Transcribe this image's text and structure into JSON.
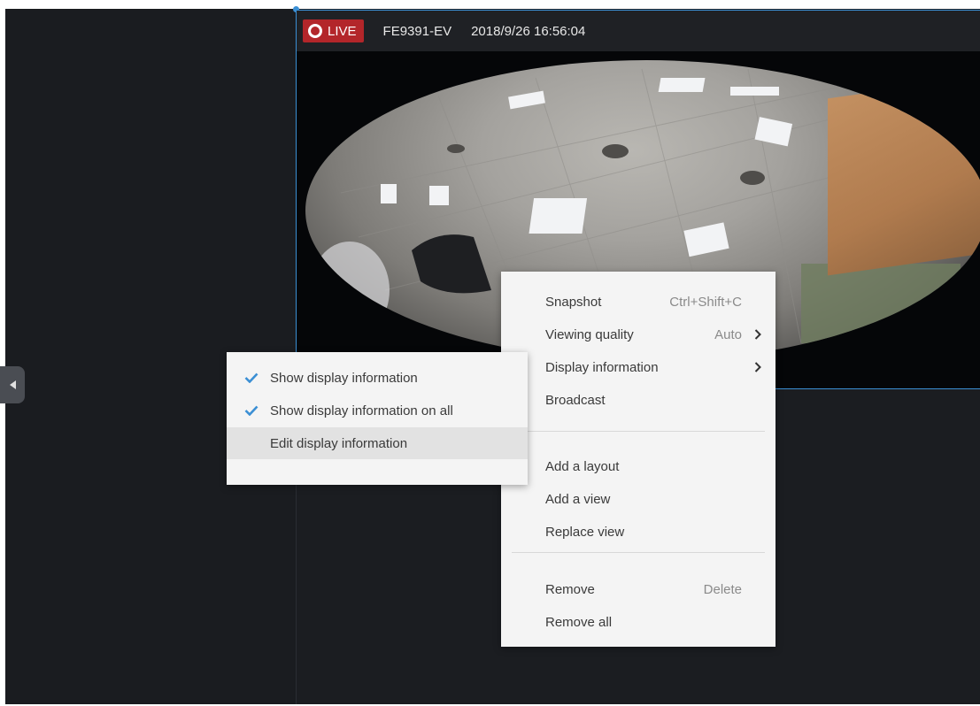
{
  "video": {
    "live_label": "LIVE",
    "camera_name": "FE9391-EV",
    "timestamp": "2018/9/26 16:56:04"
  },
  "context_menu": {
    "snapshot": {
      "label": "Snapshot",
      "shortcut": "Ctrl+Shift+C"
    },
    "viewing_quality": {
      "label": "Viewing quality",
      "value": "Auto"
    },
    "display_information": {
      "label": "Display information"
    },
    "broadcast": {
      "label": "Broadcast"
    },
    "add_layout": {
      "label": "Add a layout"
    },
    "add_view": {
      "label": "Add a view"
    },
    "replace_view": {
      "label": "Replace view"
    },
    "remove": {
      "label": "Remove",
      "shortcut": "Delete"
    },
    "remove_all": {
      "label": "Remove all"
    }
  },
  "submenu": {
    "show_display_information": {
      "label": "Show display information",
      "checked": true
    },
    "show_display_information_all": {
      "label": "Show display information on all",
      "checked": true
    },
    "edit_display_information": {
      "label": "Edit display information",
      "checked": false
    }
  },
  "colors": {
    "accent": "#3b8fd4",
    "live_badge": "#b3262a",
    "background": "#1b1d21",
    "menu_bg": "#f4f4f4",
    "menu_hover": "#e2e2e2"
  }
}
